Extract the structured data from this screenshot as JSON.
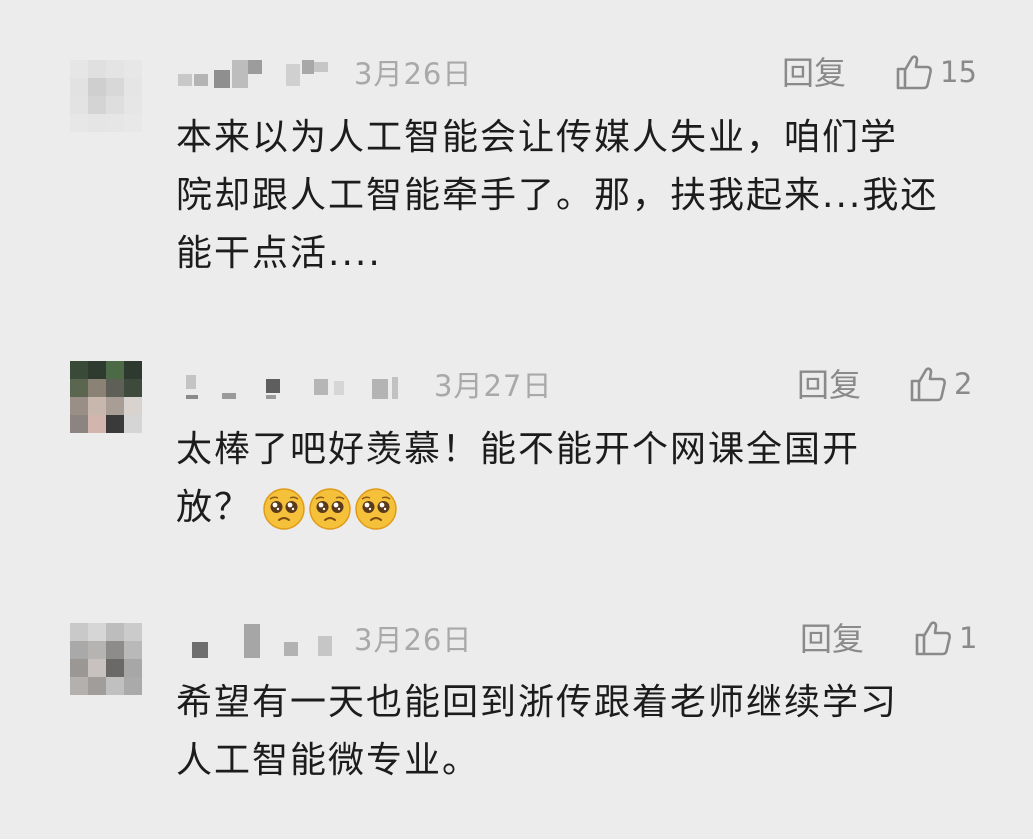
{
  "comments": [
    {
      "date": "3月26日",
      "reply_label": "回复",
      "like_count": "15",
      "text": "本来以为人工智能会让传媒人失业，咱们学\n院却跟人工智能牵手了。那，扶我起来...我还\n能干点活....",
      "emoji_count": 0
    },
    {
      "date": "3月27日",
      "reply_label": "回复",
      "like_count": "2",
      "text": "太棒了吧好羡慕！能不能开个网课全国开\n放？",
      "emoji_count": 3,
      "emoji_name": "pleading-face-emoji"
    },
    {
      "date": "3月26日",
      "reply_label": "回复",
      "like_count": "1",
      "text": "希望有一天也能回到浙传跟着老师继续学习\n人工智能微专业。",
      "emoji_count": 0
    }
  ],
  "icons": {
    "like": "thumbs-up-icon",
    "avatar": "pixelated-avatar"
  },
  "colors": {
    "background": "#ececec",
    "meta_text": "#a9a9a9",
    "action_text": "#8a8a8a",
    "body_text": "#1c1c1c"
  }
}
